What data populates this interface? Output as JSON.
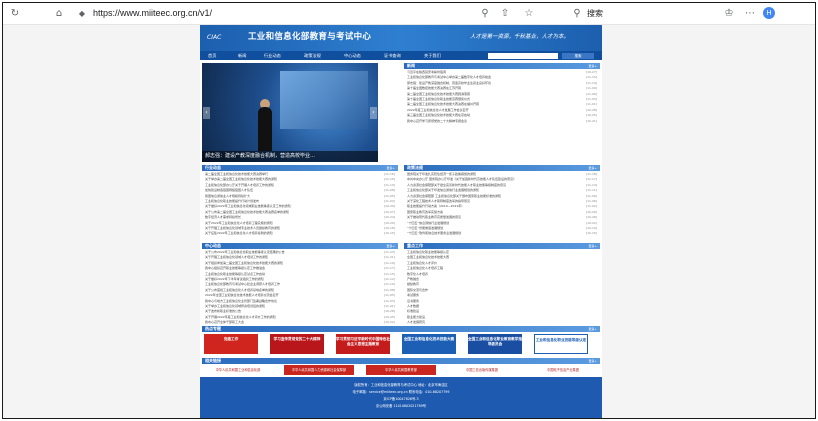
{
  "browser": {
    "url": "https://www.miiteec.org.cn/v1/",
    "search_label": "搜索",
    "badge": "H"
  },
  "header": {
    "logo_text": "CIAC",
    "title": "工业和信息化部教育与考试中心",
    "slogan": "人才是第一资源，千秋基业，人才为本。"
  },
  "nav": {
    "items": [
      "首页",
      "新闻",
      "行业动态",
      "政策法规",
      "中心动态",
      "证书查询",
      "关于我们"
    ],
    "search_placeholder": "",
    "search_button": "搜索"
  },
  "banner": {
    "caption": "郝志强：建设产教深度融合机制，营造高校毕业…",
    "dots": 5
  },
  "panels": {
    "news": {
      "title": "新闻",
      "more": "更多+",
      "items": [
        {
          "text": "习近平在陕西延安考察时强调",
          "date": "[10-27]"
        },
        {
          "text": "工业和信息化部教育与考试中心举办第二届数字化人才培养峰会",
          "date": "[11-15]"
        },
        {
          "text": "郝志强：建设产教深度融合机制，营造高校毕业生就业良好环境",
          "date": "[11-14]"
        },
        {
          "text": "第十届全国数控技能大赛决赛在江苏开幕",
          "date": "[11-09]"
        },
        {
          "text": "第二届全国工业和信息化技术技能大赛圆满落幕",
          "date": "[11-06]"
        },
        {
          "text": "第十届全国工业和信息化职业技能竞赛颁奖仪式",
          "date": "[11-03]"
        },
        {
          "text": "第二届全国工业和信息化技术技能大赛决赛在福州开幕",
          "date": "[11-01]"
        },
        {
          "text": "2022年度工业和信息化人才发展工作会议召开",
          "date": "[10-28]"
        },
        {
          "text": "第三届全国工业和信息化技术技能大赛在京启动",
          "date": "[10-25]"
        },
        {
          "text": "我中心召开学习贯彻党的二十大精神专题会议",
          "date": "[10-21]"
        }
      ]
    },
    "industry": {
      "title": "行业动态",
      "more": "更多+",
      "items": [
        {
          "text": "第二届全国工业和信息化技术技能大赛决赛举行",
          "date": "[11-16]"
        },
        {
          "text": "关于举办第二届全国工业和信息化技术技能大赛的通知",
          "date": "[11-15]"
        },
        {
          "text": "工业和信息化部办公厅关于开展人才培养工作的通知",
          "date": "[11-10]"
        },
        {
          "text": "加快建设制造强国网络强国人才队伍",
          "date": "[11-08]"
        },
        {
          "text": "我国信息通信业人才规模持续扩大",
          "date": "[11-05]"
        },
        {
          "text": "工业和信息化职业技能提升行动计划发布",
          "date": "[11-02]"
        },
        {
          "text": "关于做好2022年工业和信息化领域职业技能等级认定工作的通知",
          "date": "[10-30]"
        },
        {
          "text": "关于公布第二届全国工业和信息化技术技能大赛决赛名单的通知",
          "date": "[10-27]"
        },
        {
          "text": "数字经济人才需求持续增长",
          "date": "[10-24]"
        },
        {
          "text": "关于2022年工业和信息化人才培养工程实施的通知",
          "date": "[10-20]"
        },
        {
          "text": "关于开展工业和信息化领域专业技术人员继续教育的通知",
          "date": "[10-18]"
        },
        {
          "text": "关于征集2022年工业和信息化人才培养案例的通知",
          "date": "[10-15]"
        }
      ]
    },
    "policy": {
      "title": "政策法规",
      "more": "更多+",
      "items": [
        {
          "text": "国务院关于印发扎实稳住经济一揽子政策措施的通知",
          "date": "[11-18]"
        },
        {
          "text": "中共中央办公厅 国务院办公厅印发《关于加强新时代高技能人才队伍建设的意见》",
          "date": "[11-17]"
        },
        {
          "text": "人力资源社会保障部关于健全完善新时代技能人才职业技能等级制度的意见",
          "date": "[11-14]"
        },
        {
          "text": "工业和信息化部关于印发信息通信行业发展规划的通知",
          "date": "[11-11]"
        },
        {
          "text": "人力资源社会保障部 工业和信息化部关于颁布国家职业技能标准的通知",
          "date": "[11-09]"
        },
        {
          "text": "关于深化工程技术人才职称制度改革的指导意见",
          "date": "[11-06]"
        },
        {
          "text": "职业技能提升行动方案（2019—2021年）",
          "date": "[11-02]"
        },
        {
          "text": "国家职业教育改革实施方案",
          "date": "[10-29]"
        },
        {
          "text": "关于推动现代职业教育高质量发展的意见",
          "date": "[10-26]"
        },
        {
          "text": "“十四五”信息通信行业发展规划",
          "date": "[10-22]"
        },
        {
          "text": "“十四五”智能制造发展规划",
          "date": "[10-19]"
        },
        {
          "text": "“十四五”软件和信息技术服务业发展规划",
          "date": "[10-15]"
        }
      ]
    },
    "center": {
      "title": "中心动态",
      "more": "更多+",
      "items": [
        {
          "text": "关于公布2022年工业和信息化职业技能等级认定结果的公告",
          "date": "[11-23]"
        },
        {
          "text": "关于开展工业和信息化领域人才培训工作的通知",
          "date": "[11-21]"
        },
        {
          "text": "关于组织参加第二届全国工业和信息化技术技能大赛的通知",
          "date": "[11-19]"
        },
        {
          "text": "我中心组织召开职业技能等级认定工作推进会",
          "date": "[11-17]"
        },
        {
          "text": "工业和信息化职业技能等级认定试点工作启动",
          "date": "[11-15]"
        },
        {
          "text": "关于做好2022年下半年考试组织工作的通知",
          "date": "[11-12]"
        },
        {
          "text": "工业和信息化部教育与考试中心赴企业调研人才培养工作",
          "date": "[11-10]"
        },
        {
          "text": "关于公布首批工业和信息化人才培养基地名单的通知",
          "date": "[11-08]"
        },
        {
          "text": "2022年全国工业和信息化技术技能人才培养交流会召开",
          "date": "[11-05]"
        },
        {
          "text": "我中心与地方工业和信息化主管部门签署战略合作协议",
          "date": "[11-03]"
        },
        {
          "text": "关于举办工业和信息化领域师资培训班的通知",
          "date": "[11-01]"
        },
        {
          "text": "关于发布新职业标准的公告",
          "date": "[10-28]"
        },
        {
          "text": "关于开展2022年度工业和信息化人才评价工作的通知",
          "date": "[10-25]"
        },
        {
          "text": "我中心召开全体干部职工大会",
          "date": "[10-22]"
        },
        {
          "text": "关于启用新版证书查询系统的通知",
          "date": "[10-19]"
        }
      ]
    },
    "key_work": {
      "title": "重点工作",
      "more": "更多+",
      "items": [
        {
          "text": "工业和信息化职业技能等级认定",
          "date": ""
        },
        {
          "text": "全国工业和信息化技术技能大赛",
          "date": ""
        },
        {
          "text": "工业和信息化人才评价",
          "date": ""
        },
        {
          "text": "工业和信息化人才培养工程",
          "date": ""
        },
        {
          "text": "数字化人才培养",
          "date": ""
        },
        {
          "text": "产教融合",
          "date": ""
        },
        {
          "text": "继续教育",
          "date": ""
        },
        {
          "text": "国际交流与合作",
          "date": ""
        },
        {
          "text": "考试服务",
          "date": ""
        },
        {
          "text": "证书服务",
          "date": ""
        },
        {
          "text": "人才数据",
          "date": ""
        },
        {
          "text": "标准建设",
          "date": ""
        },
        {
          "text": "职业能力建设",
          "date": ""
        },
        {
          "text": "人才发展研究",
          "date": ""
        },
        {
          "text": "党建工作",
          "date": ""
        }
      ]
    }
  },
  "topics": {
    "title": "热点专题",
    "more": "更多+",
    "tiles": [
      {
        "text": "党建工作",
        "color": "#d0251e"
      },
      {
        "text": "学习宣传贯彻党的二十大精神",
        "color": "#b8161b"
      },
      {
        "text": "学习贯彻习近平新时代中国特色社会主义思想主题教育",
        "color": "#c41c1c"
      },
      {
        "text": "全国工业和信息化技术技能大赛",
        "color": "#1d5fb5"
      },
      {
        "text": "全国工业和信息化职业教育教学指导委员会",
        "color": "#1a4ea3"
      },
      {
        "text": "工业和信息化职业技能等级认定",
        "color": "#ffffff"
      }
    ]
  },
  "links": {
    "title": "相关链接",
    "more": "更多+",
    "items": [
      "中华人民共和国工业和信息化部",
      "中华人民共和国人力资源和社会保障部",
      "中华人民共和国教育部",
      "中国工信出版传媒集团",
      "中国电子信息产业集团"
    ]
  },
  "footer": {
    "line1": "版权所有：工业和信息化部教育与考试中心  地址：北京市海淀区",
    "line2": "电子邮箱：service@miiteec.org.cn  联系电话：010-68207799",
    "line3": "京ICP备10047826号-3",
    "line4": "京公网安备 11010802021789号"
  }
}
